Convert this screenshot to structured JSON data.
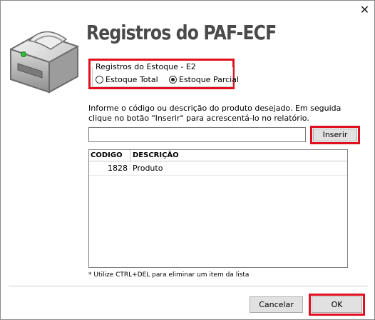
{
  "window": {
    "title": "Registros do PAF-ECF",
    "close_icon": "close-icon"
  },
  "estoque_group": {
    "legend": "Registros do Estoque - E2",
    "options": [
      {
        "label": "Estoque Total",
        "selected": false
      },
      {
        "label": "Estoque Parcial",
        "selected": true
      }
    ]
  },
  "instructions": "Informe o código ou descrição do produto desejado. Em seguida clique no botão \"Inserir\" para acrescentá-lo no relatório.",
  "search": {
    "value": "",
    "placeholder": ""
  },
  "insert_button": "Inserir",
  "table": {
    "columns": [
      "CODIGO",
      "DESCRIÇÃO"
    ],
    "rows": [
      {
        "codigo": "1828",
        "descricao": "Produto"
      }
    ]
  },
  "footnote": "* Utilize CTRL+DEL para eliminar um item da lista",
  "footer": {
    "cancel_label": "Cancelar",
    "ok_label": "OK"
  },
  "colors": {
    "highlight": "#e01020",
    "title": "#4a4a4a",
    "button_face": "#e1e1e1"
  }
}
